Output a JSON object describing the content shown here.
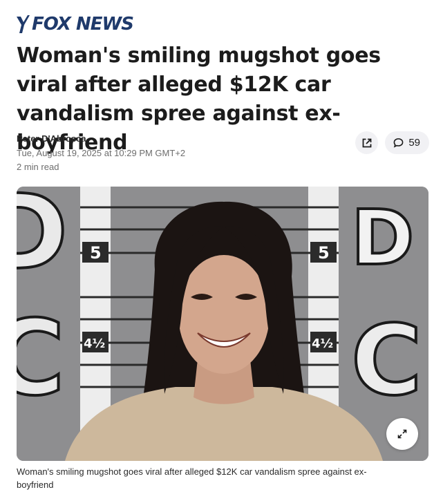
{
  "brand": {
    "name": "FOX NEWS",
    "color": "#1f3a6b"
  },
  "article": {
    "headline": "Woman's smiling mugshot goes viral after alleged $12K car vandalism spree against ex-boyfriend",
    "author": "Peter D'Abrosca",
    "published": "Tue, August 19, 2025 at 10:29 PM GMT+2",
    "read_time": "2 min read"
  },
  "actions": {
    "share_icon": "share-icon",
    "comments_icon": "comment-icon",
    "comments_count": "59"
  },
  "image": {
    "description_icon": "expand-icon",
    "height_board_labels": [
      "5",
      "5",
      "4½",
      "4½"
    ],
    "wall_letters": [
      "D",
      "C",
      "D",
      "C"
    ],
    "caption": "Woman's smiling mugshot goes viral after alleged $12K car vandalism spree against ex-boyfriend"
  }
}
